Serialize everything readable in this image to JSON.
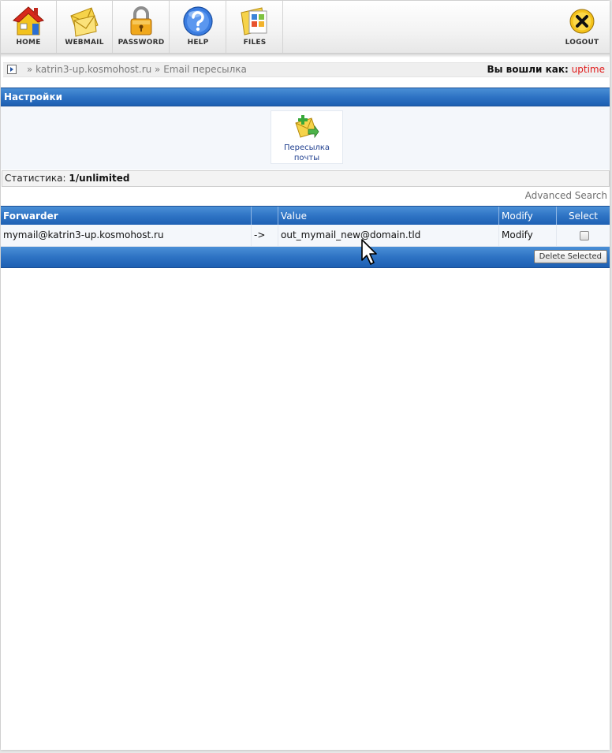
{
  "toolbar": {
    "items": [
      {
        "label": "HOME",
        "icon": "house-icon"
      },
      {
        "label": "WEBMAIL",
        "icon": "envelope-icon"
      },
      {
        "label": "PASSWORD",
        "icon": "padlock-icon"
      },
      {
        "label": "HELP",
        "icon": "question-icon"
      },
      {
        "label": "FILES",
        "icon": "folder-icon"
      }
    ],
    "logout": {
      "label": "LOGOUT",
      "icon": "close-circle-icon"
    }
  },
  "breadcrumb": {
    "text": "» katrin3-up.kosmohost.ru » Email пересылка"
  },
  "login": {
    "label": "Вы вошли как:",
    "user": "uptime"
  },
  "settings": {
    "title": "Настройки",
    "feature": {
      "line1": "Пересылка",
      "line2": "почты",
      "icon": "mail-forward-icon"
    }
  },
  "stats": {
    "label": "Статистика:",
    "value": "1/unlimited"
  },
  "advanced_search": "Advanced Search",
  "table": {
    "headers": {
      "forwarder": "Forwarder",
      "arrow": "",
      "value": "Value",
      "modify": "Modify",
      "select": "Select"
    },
    "rows": [
      {
        "forwarder": "mymail@katrin3-up.kosmohost.ru",
        "arrow": "->",
        "value": "out_mymail_new@domain.tld",
        "modify": "Modify",
        "selected": false
      }
    ],
    "delete_button": "Delete Selected"
  },
  "colors": {
    "header_blue": "#2e73c4",
    "username_red": "#e01a1a",
    "link_blue": "#1f3f8f"
  }
}
